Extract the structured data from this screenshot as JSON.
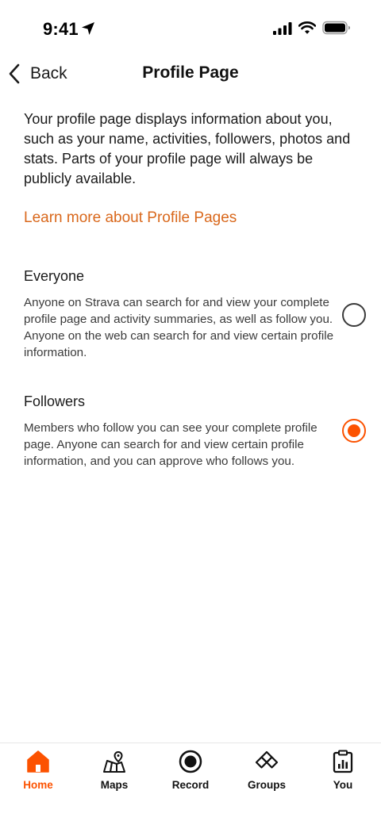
{
  "status_bar": {
    "time": "9:41"
  },
  "nav": {
    "back_label": "Back",
    "title": "Profile Page"
  },
  "intro_text": "Your profile page displays information about you, such as your name, activities, followers, photos and stats. Parts of your profile page will always be publicly available.",
  "learn_more_link": "Learn more about Profile Pages",
  "options": [
    {
      "title": "Everyone",
      "description": "Anyone on Strava can search for and view your complete profile page and activity summaries, as well as follow you. Anyone on the web can search for and view certain profile information.",
      "selected": false
    },
    {
      "title": "Followers",
      "description": "Members who follow you can see your complete profile page. Anyone can search for and view certain profile information, and you can approve who follows you.",
      "selected": true
    }
  ],
  "tabs": [
    {
      "label": "Home",
      "icon": "home-icon",
      "active": true
    },
    {
      "label": "Maps",
      "icon": "map-icon",
      "active": false
    },
    {
      "label": "Record",
      "icon": "record-icon",
      "active": false
    },
    {
      "label": "Groups",
      "icon": "groups-icon",
      "active": false
    },
    {
      "label": "You",
      "icon": "clipboard-icon",
      "active": false
    }
  ],
  "colors": {
    "accent": "#fc5200",
    "link": "#d9681c",
    "text": "#1a1a1a"
  }
}
